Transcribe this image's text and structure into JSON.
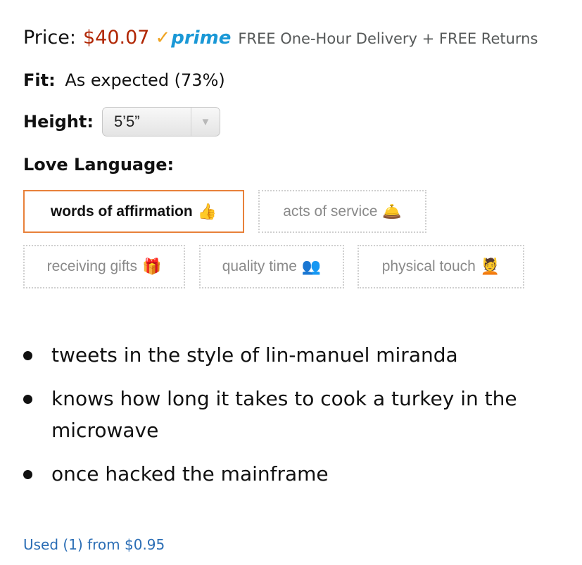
{
  "price": {
    "label": "Price:",
    "value": "$40.07",
    "prime_check": "✓",
    "prime_text": "prime",
    "delivery": "FREE One-Hour Delivery + FREE Returns"
  },
  "fit": {
    "label": "Fit:",
    "value": "As expected (73%)"
  },
  "height": {
    "label": "Height:",
    "selected": "5’5”"
  },
  "love_language": {
    "label": "Love Language:",
    "options": [
      {
        "label": "words of affirmation",
        "emoji": "👍",
        "selected": true
      },
      {
        "label": "acts of service",
        "emoji": "🛎️",
        "selected": false
      },
      {
        "label": "receiving gifts",
        "emoji": "🎁",
        "selected": false
      },
      {
        "label": "quality time",
        "emoji": "👥",
        "selected": false
      },
      {
        "label": "physical touch",
        "emoji": "💆",
        "selected": false
      }
    ]
  },
  "bullets": [
    "tweets in the style of lin-manuel miranda",
    "knows how long it takes to cook a turkey in the microwave",
    "once hacked the mainframe"
  ],
  "used_offer": "Used (1) from $0.95",
  "colors": {
    "price": "#b12704",
    "prime_check": "#f0a422",
    "prime_text": "#1a98d6",
    "selected_border": "#e8813a",
    "link": "#2a6db5"
  }
}
